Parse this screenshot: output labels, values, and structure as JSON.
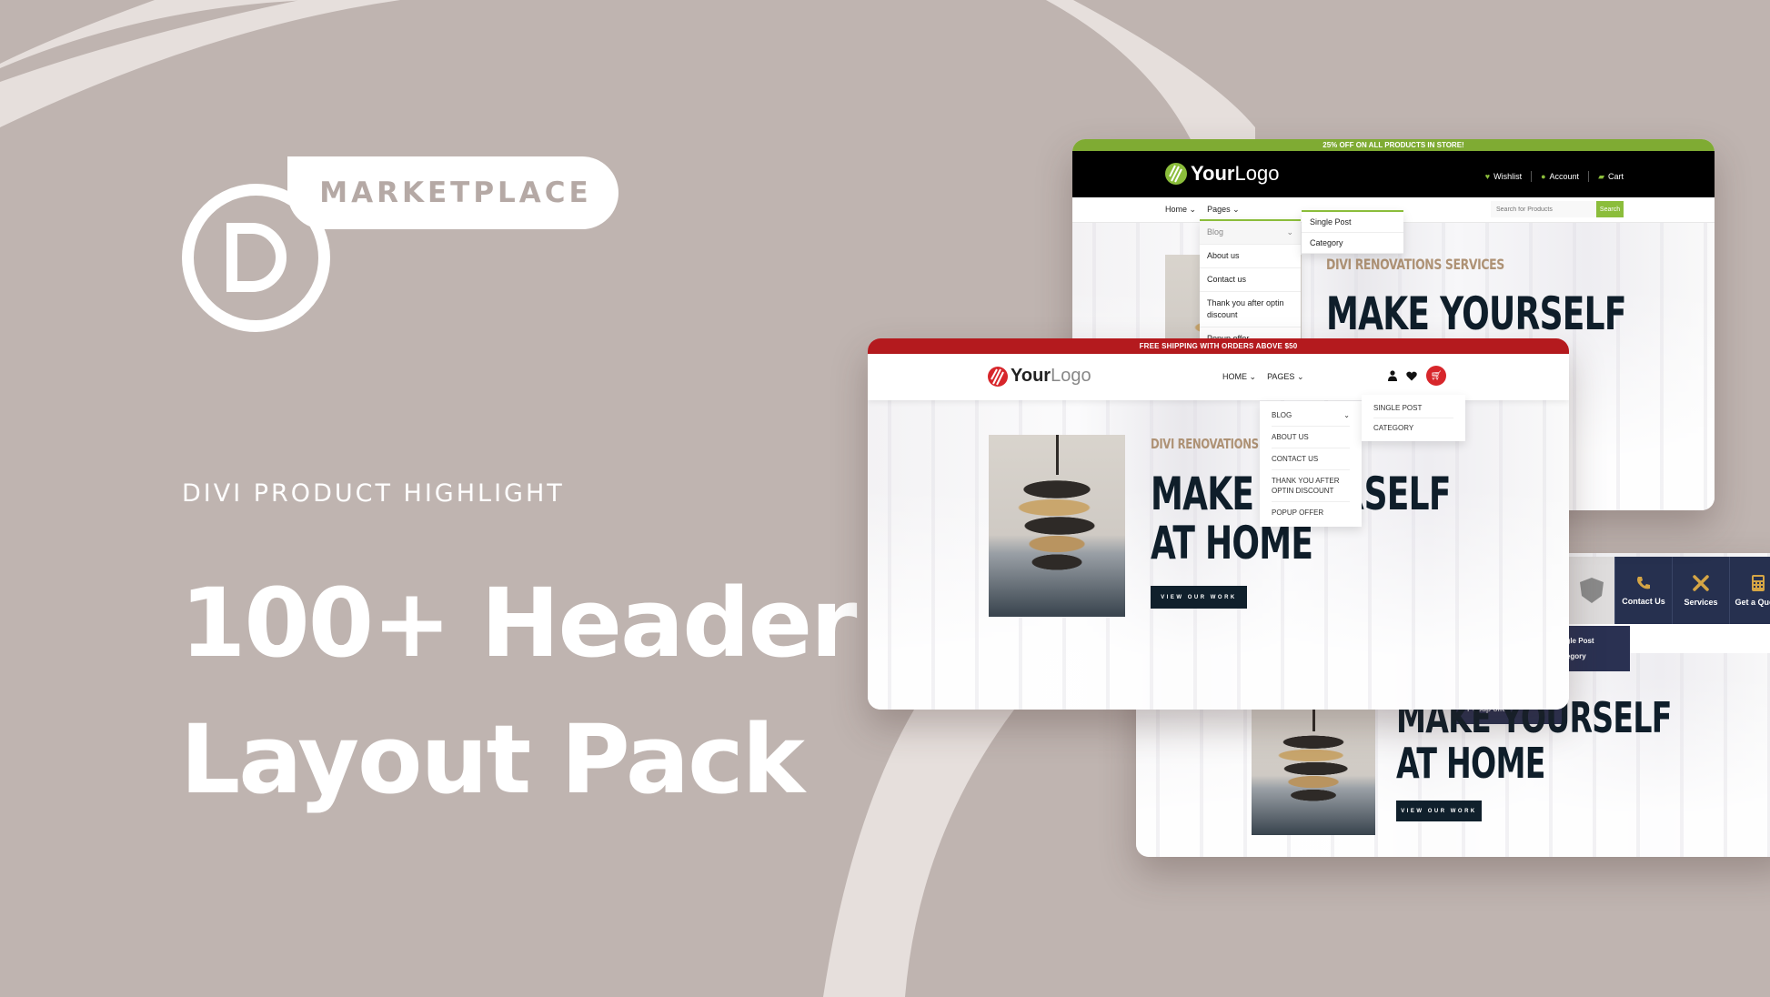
{
  "brand": {
    "badge_label": "MARKETPLACE",
    "logo_icon": "divi-d-logo-icon"
  },
  "hero": {
    "eyebrow": "DIVI PRODUCT HIGHLIGHT",
    "title_line1": "100+ Header",
    "title_line2": "Layout Pack"
  },
  "colors": {
    "background": "#bfb4b0",
    "green_accent": "#8bbd3b",
    "red_accent": "#d7262b",
    "navy_accent": "#26304f",
    "tan_eyebrow": "#ae9275",
    "dark_heading": "#0f1e2a"
  },
  "card_green": {
    "announcement": "25% OFF ON ALL PRODUCTS IN STORE!",
    "logo_bold": "Your",
    "logo_light": "Logo",
    "utility_links": [
      {
        "icon": "heart-icon",
        "label": "Wishlist"
      },
      {
        "icon": "user-icon",
        "label": "Account"
      },
      {
        "icon": "cart-icon",
        "label": "Cart"
      }
    ],
    "nav": [
      {
        "label": "Home"
      },
      {
        "label": "Pages"
      }
    ],
    "search_placeholder": "Search for Products",
    "search_button": "Search",
    "dropdown": [
      "Blog",
      "About us",
      "Contact us",
      "Thank you after optin discount",
      "Popup offer"
    ],
    "subdropdown": [
      "Single Post",
      "Category"
    ],
    "eyebrow": "DIVI RENOVATIONS SERVICES",
    "headline": "MAKE YOURSELF"
  },
  "card_red": {
    "announcement": "FREE SHIPPING WITH ORDERS ABOVE $50",
    "logo_bold": "Your",
    "logo_light": "Logo",
    "nav": [
      {
        "label": "HOME"
      },
      {
        "label": "PAGES"
      }
    ],
    "dropdown": [
      "BLOG",
      "ABOUT US",
      "CONTACT US",
      "THANK YOU AFTER OPTIN DISCOUNT",
      "POPUP OFFER"
    ],
    "subdropdown": [
      "SINGLE POST",
      "CATEGORY"
    ],
    "eyebrow": "DIVI RENOVATIONS SERVICES",
    "headline_line1": "MAKE YOURSELF",
    "headline_line2": "AT HOME",
    "cta": "VIEW OUR WORK"
  },
  "card_navy": {
    "icon_nav": [
      {
        "icon": "phone-icon",
        "label": "Contact Us"
      },
      {
        "icon": "tools-icon",
        "label": "Services"
      },
      {
        "icon": "calculator-icon",
        "label": "Get a Quote"
      }
    ],
    "subdropdown": [
      "Single Post",
      "Category"
    ],
    "popup_item": "Popup offer",
    "headline_line1": "MAKE YOURSELF",
    "headline_line2": "AT HOME",
    "cta": "VIEW OUR WORK"
  }
}
